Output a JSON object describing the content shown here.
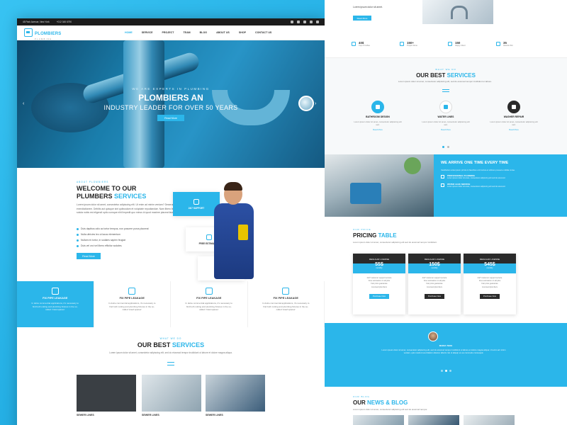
{
  "topbar": {
    "address": "45 Park Avenue, New York",
    "phone": "+012 345 6790"
  },
  "nav": {
    "logo": "PLOMBIERS",
    "logo_sub": "PLUMBING",
    "items": [
      "HOME",
      "SERVICE",
      "PROJECT",
      "TEAM",
      "BLOG",
      "ABOUT US",
      "SHOP",
      "CONTACT US"
    ],
    "active_index": 0
  },
  "hero": {
    "tagline": "WE ARE EXPERTS IN PLUMBING",
    "title_line1": "PLOMBIERS AN",
    "title_line2": "INDUSTRY LEADER FOR OVER 50 YEARS",
    "button": "Read More",
    "prev": "‹",
    "next": "›"
  },
  "welcome": {
    "kicker": "ABOUT PLOMBIERS",
    "title_line1": "WELCOME TO OUR",
    "title_line2_a": "PLUMBERS ",
    "title_line2_b": "SERVICES",
    "paragraph": "Lorem ipsum dolor sit amet, consectetur adipiscing elit. Ut enim ad minim veniam? Deserunt, numquam exercitationem. Debitis aut quisque sint quibusdam et voluptate repudiandae. Nam libero tempore cum soluta nobis est eligendi optio cumque nihil impedit quo minus id quod maxime placeat facere possimus.",
    "list": [
      "Duis dapibus odio ac tortor tempus, non posuere purus placerat",
      "Nulla ultricies leo ut lacus elementum",
      "Nullam mi tortor, in sodales sapien feugiat",
      "Duis vel orci vel libero efficitur sodales."
    ],
    "button": "Read More",
    "features": [
      "24/7 SUPPORT",
      "FREE ESTIMATION",
      "FAIR PRICE"
    ]
  },
  "strip": [
    {
      "title": "FIX PIPE LEAKAGE",
      "desc": "In dulce commercial applications, it's necessary to find both cutting and plumbing fixtures in the so-called 'crawl spaces'"
    },
    {
      "title": "FIX PIPE LEAKAGE",
      "desc": "In dulce commercial applications, it's necessary to find both cutting and plumbing fixtures in the so-called 'crawl spaces'"
    },
    {
      "title": "FIX PIPE LEAKAGE",
      "desc": "In dulce commercial applications, it's necessary to find both cutting and plumbing fixtures in the so-called 'crawl spaces'"
    },
    {
      "title": "FIX PIPE LEAKAGE",
      "desc": "In dulce commercial applications, it's necessary to find both cutting and plumbing fixtures in the so-called 'crawl spaces'"
    }
  ],
  "services_left": {
    "kicker": "WHAT WE DO",
    "title_a": "OUR BEST ",
    "title_b": "SERVICES",
    "desc": "Lorem ipsum dolor sit amet, consectetur adipiscing elit, sed do eiusmod tempor incididunt ut labore et dolore magna aliqua.",
    "items": [
      "SEWER LINES",
      "SEWER LINES",
      "SEWER LINES"
    ]
  },
  "right_top": {
    "text": "Lorem ipsum dolor sit amet.",
    "button": "Read More"
  },
  "stats": [
    {
      "num": "40$",
      "label": "Cup of Coffee"
    },
    {
      "num": "150+",
      "label": "Project Done"
    },
    {
      "num": "150",
      "label": "Happy Client"
    },
    {
      "num": "35",
      "label": "Awards Win"
    }
  ],
  "services_right": {
    "kicker": "WHAT WE DO",
    "title_a": "OUR BEST ",
    "title_b": "SERVICES",
    "desc": "Lorem ipsum dolor sit amet, consectetur adipiscing elit, sed do eiusmod tempor incididunt ut labore.",
    "items": [
      {
        "title": "BATHROOM DESIGN",
        "desc": "Lorem ipsum dolor sit amet, consectetur adipiscing elit sed.",
        "more": "Read More"
      },
      {
        "title": "WATER LINES",
        "desc": "Lorem ipsum dolor sit amet, consectetur adipiscing elit sed.",
        "more": "Read More"
      },
      {
        "title": "WASHER REPAIR",
        "desc": "Lorem ipsum dolor sit amet, consectetur adipiscing elit sed.",
        "more": "Read More"
      }
    ]
  },
  "arrive": {
    "title": "WE ARRIVE ONE TIME EVERY TIME",
    "desc": "Vestibulum ante ipsum primis in faucibus orci luctus et ultrices posuere cubilia curae.",
    "items": [
      {
        "title": "PROFESSIONAL PLUMBING",
        "desc": "Lorem ipsum dolor sit amet, consectetur adipiscing elit sed do eiusmod."
      },
      {
        "title": "WATER LEAK SERVICE",
        "desc": "Lorem ipsum dolor sit amet, consectetur adipiscing elit sed do eiusmod."
      }
    ]
  },
  "pricing": {
    "kicker": "OUR PRICE",
    "title_a": "PRICING ",
    "title_b": "TABLE",
    "desc": "Lorem ipsum dolor sit amet, consectetur adipiscing elit sed do eiusmod tempor incididunt.",
    "plans": [
      {
        "name": "REGULAR LICENSE",
        "price": "55$",
        "period": "monthly",
        "button": "Purchase Now"
      },
      {
        "name": "REGULAR LICENSE",
        "price": "150$",
        "period": "monthly",
        "button": "Purchase Now"
      },
      {
        "name": "REGULAR LICENSE",
        "price": "545$",
        "period": "monthly",
        "button": "Purchase Now"
      }
    ],
    "features": "24/7 customer support service\nFree estimation on all jobs\nFair price guarantee\nLicensed plumbers"
  },
  "testimonial": {
    "name": "MARIA TEKE",
    "quote": "Lorem ipsum dolor sit amet, consectetur adipiscing elit, sed do eiusmod tempor incididunt ut labore et dolore magna aliqua. Ut enim ad minim veniam, quis nostrud exercitation ullamco laboris nisi ut aliquip ex ea commodo consequat."
  },
  "news": {
    "kicker": "OUR BLOG",
    "title_a": "OUR ",
    "title_b": "NEWS & BLOG",
    "desc": "Lorem ipsum dolor sit amet, consectetur adipiscing elit sed do eiusmod tempor."
  },
  "colors": {
    "accent": "#2bb6ea",
    "dark": "#1c1c1c"
  }
}
